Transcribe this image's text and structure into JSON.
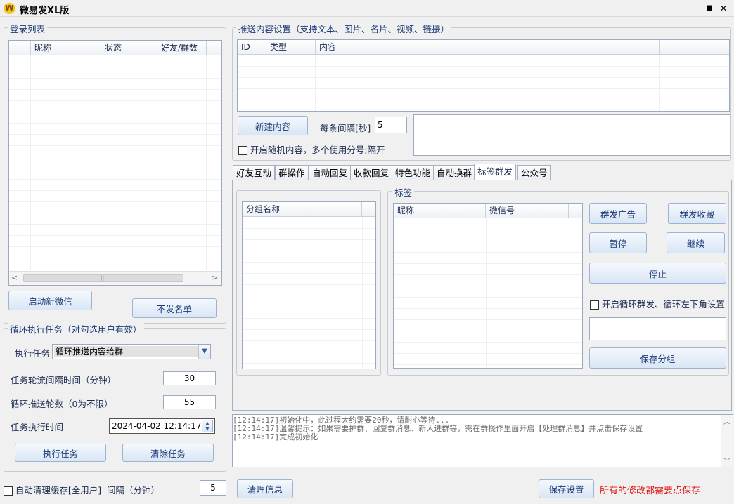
{
  "window": {
    "title": "微易发XL版",
    "logo": "W",
    "minimize": "_",
    "maximize": "■",
    "close": "✕"
  },
  "login": {
    "title": "登录列表",
    "columns": [
      "",
      "昵称",
      "状态",
      "好友/群数"
    ],
    "start_button": "启动新微信",
    "blocklist_button": "不发名单",
    "scroll_left": "<",
    "scroll_right": ">",
    "scroll_thumb": "|||"
  },
  "loop_task": {
    "title": "循环执行任务（对勾选用户有效）",
    "exec_label": "执行任务",
    "exec_value": "循环推送内容给群",
    "interval_label": "任务轮流间隔时间（分钟）",
    "interval_value": "30",
    "rounds_label": "循环推送轮数（0为不限）",
    "rounds_value": "55",
    "time_label": "任务执行时间",
    "time_value": "2024-04-02 12:14:17",
    "run_button": "执行任务",
    "clear_button": "清除任务"
  },
  "bottom_left": {
    "auto_clear_label": "自动清理缓存[全用户]",
    "interval_label": "间隔（分钟）",
    "interval_value": "5"
  },
  "push": {
    "title": "推送内容设置（支持文本、图片、名片、视频、链接）",
    "columns": [
      "ID",
      "类型",
      "内容",
      ""
    ],
    "new_button": "新建内容",
    "each_interval_label": "每条间隔[秒]",
    "each_interval_value": "5",
    "random_label": "开启随机内容，多个使用分号;隔开"
  },
  "tabs": [
    "好友互动",
    "群操作",
    "自动回复",
    "收款回复",
    "特色功能",
    "自动换群",
    "标签群发",
    "公众号"
  ],
  "tag_panel": {
    "group_columns": [
      "分组名称",
      ""
    ],
    "tag_title": "标签",
    "tag_columns": [
      "昵称",
      "微信号",
      ""
    ],
    "mass_ad_button": "群发广告",
    "mass_fav_button": "群发收藏",
    "pause_button": "暂停",
    "resume_button": "继续",
    "stop_button": "停止",
    "loop_label": "开启循环群发、循环左下角设置",
    "save_group_button": "保存分组"
  },
  "log": {
    "lines": [
      "[12:14:17]初始化中，此过程大约需要20秒，请耐心等待...",
      "[12:14:17]温馨提示：如果需要护群、回复群消息、新人进群等，需在群操作里面开启【处理群消息】并点击保存设置",
      "[12:14:17]完成初始化"
    ],
    "scroll_up": "︿",
    "scroll_down": "﹀"
  },
  "footer": {
    "clear_button": "清理信息",
    "save_button": "保存设置",
    "warning": "所有的修改都需要点保存"
  },
  "colors": {
    "warning": "#e01010",
    "accent": "#1a3a78"
  }
}
